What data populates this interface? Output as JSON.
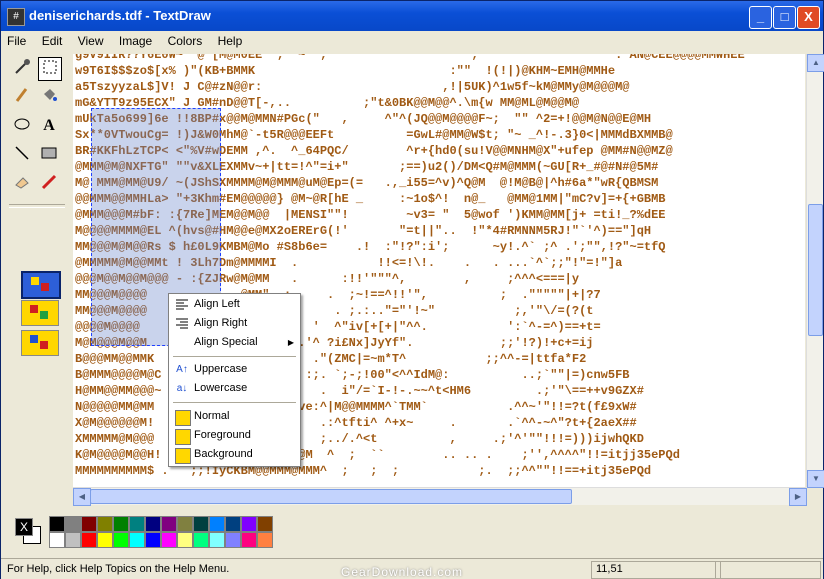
{
  "window": {
    "title": "deniserichards.tdf - TextDraw",
    "app_icon": "#",
    "minimize": "_",
    "maximize": "□",
    "close": "X"
  },
  "menu": [
    "File",
    "Edit",
    "View",
    "Image",
    "Colors",
    "Help"
  ],
  "tools": [
    "eyedropper-icon",
    "select-rect-icon",
    "pencil-icon",
    "fill-bucket-icon",
    "ellipse-icon",
    "text-icon",
    "line-icon",
    "rectangle-icon",
    "eraser-icon",
    "brush-icon"
  ],
  "tool_glyphs": {
    "text": "A"
  },
  "canvas_lines": [
    "g9V9IIR??Y6E0W~  @ [M@M0EE  ;  ~  ;                    ;                '  . AN@CEE@@@@MMWHEE",
    "w9T6I$$$zo$[x% )\"(KB+BMMK                           :\"\"  !(!|)@KHM~EMH@MMHe",
    "a5TszyyzaL$]V! J C@#zN@@r:                         ,!|5UK)^1w5f~kM@MMy@M@@@M@",
    "mG&YTT9z95ECX\" J GM#nD@@T[-,..          ;\"t&0BK@@M@@^.\\m{w MM@ML@M@@M@",
    "mUkTa5o699]6e !!8BP#x@@M@MMN#PGc(\"   ,     ^\"^(JQ@@M@@@@F~;  \"\" ^2=+!@@M@N@@E@MH",
    "Sx**0VTwouCg= !)J&W0MhM@`-t5R@@@EEFt          =GwL#@MM@W$t; \"~ _^!-.3}0<|MMMdBXMMB@",
    "BR#KKFhLzTCP< <\"%V#wDEMM ,^.  ^_64PQC/        ^r+{hd0(su!V@@MNHM@X\"+ufep @MM#N@@MZ@",
    "@MMM@M@NXFTG\" \"\"v&XLEXMMv~+|tt=!^\"=i+\"       ;==)u2()/DM<Q#M@MMM(~GU[R+_#@#N#@5M#",
    "M@ MMM@MM@U9/ ~(JShSXMMMM@M@MMM@uM@Ep=(=   .,_i55=^v)^Q@M  @!M@B@|^h#6a*\"wR{QBMSM",
    "@@MMM@@MMHLa> \"+3Khm#EM@@@@@} @M~@R[hE _     :~1o$^!  n@_   @MM@1MM|\"mC?v]=+{+GBMB",
    "@MMM@@@M#bF: :{7Re]MEM@@M@@  |MENSI\"\"!        ~v3= \"  5@wof ')KMM@MM[j+ =ti!_?%dEE",
    "M@@@@MMMM@EL ^(hvs@#HM@@e@MX2oERErG(!'       \"=t||\"..  !\"*4#RMNNM5RJ!\"`'^)==\"]qH",
    "MM@@@M@M@@Rs $ h£0L9KMBM@Mo #S8b6e=    .!  :\"!?\":i';      ~y!.^` ;^ .';\"\",!?\"~=tfQ",
    "@MMMMM@M@@MMt ! 3Lh7Dm@MMMMI  .           !!<=!\\!.    .   . ...`^`;;\"!\"=!\"]a",
    "@@@M@@M@@M@@@ - :{ZJRw@M@MM   .      :!!'\"\"\"^,        ,     ;^^^<===|y",
    "MM@@@M@@@@             @MM\"  ;     .  ;~!==^!!'\",          ;  .\"\"\"\"\"|+|?7",
    "MM@@@M@@@@             @MM\"   ;     . ;.:..\"=\"'!~\"           ;,'\"\\/=(?(t",
    "@@@@M@@@@              Mp  ;     '  ^\"iv[+[+|\"^^.           ':`^-=^)==+t=",
    "M@M@@@M@@M             M  ;   ;.'^ ?i£Nx]JyYf\".            ;;'!?)!+c+=ij",
    "B@@@MM@@MMK            @  ^.     .\"(ZMC|=~m*T^           ;;^^-=|ttfa*F2",
    "B@MMM@@@@M@C           @? .     :;. `;-;!00\"<^^IdM@:          ..;`\"\"|=)cnw5FB",
    "H@MM@@MM@@@~           MM|   ;    .  i\"/=`I-!-.~~^t<HM6         .;'\"\\==++v9GZX#",
    "N@@@@@MM@MM            NM  ;.  ve:^|M@@MMMM^`TMM`           .^^~'\"!!=?t(f£9xW#",
    "X@M@@@@@@M!            @M@@  `:   .:^tfti^ ^+x~     .       .`^^-~^\"?t+{2aeX##",
    "XMMMMM@M@@@            @@@@@      ;../.^<t          ,     .;'^'\"\"!!!=)))ijwhQKD",
    "K@M@@@@M@@H! ~. \"!!CAh2M@YH8@M@@M  ^  ;  ``        .. .. .    ;'',^^^^\"!!=itjj35ePQd",
    "MMMMMMMMMM$ .   ;;!IyCKBM@@MMM@MMM^  ;   ;  ;           ;.  ;;^^\"\"!!==+itj35ePQd"
  ],
  "context_menu": {
    "items": [
      {
        "label": "Align Left",
        "icon": "align-left-icon"
      },
      {
        "label": "Align Right",
        "icon": "align-right-icon"
      },
      {
        "label": "Align Special",
        "icon": "",
        "submenu": true
      },
      {
        "label": "Uppercase",
        "icon": "uppercase-icon"
      },
      {
        "label": "Lowercase",
        "icon": "lowercase-icon"
      },
      {
        "label": "Normal",
        "icon": "mode-normal-icon"
      },
      {
        "label": "Foreground",
        "icon": "mode-foreground-icon"
      },
      {
        "label": "Background",
        "icon": "mode-background-icon"
      }
    ],
    "glyphs": {
      "uppercase": "A↑",
      "lowercase": "a↓",
      "submenu_arrow": "▶"
    }
  },
  "palette": {
    "current_fg": "#000000",
    "current_bg": "#ffffff",
    "fg_glyph": "X",
    "row1": [
      "#000000",
      "#808080",
      "#800000",
      "#808000",
      "#008000",
      "#008080",
      "#000080",
      "#800080",
      "#808040",
      "#004040",
      "#0080ff",
      "#004080",
      "#8000ff",
      "#804000"
    ],
    "row2": [
      "#ffffff",
      "#c0c0c0",
      "#ff0000",
      "#ffff00",
      "#00ff00",
      "#00ffff",
      "#0000ff",
      "#ff00ff",
      "#ffff80",
      "#00ff80",
      "#80ffff",
      "#8080ff",
      "#ff0080",
      "#ff8040"
    ]
  },
  "status": {
    "message": "For Help, click Help Topics on the Help Menu.",
    "position": "11,51"
  },
  "watermark": "GearDownload.com",
  "colors": {
    "text": "#a05a14",
    "title_bar": "#0a4fd6",
    "selection": "#2040ff"
  }
}
